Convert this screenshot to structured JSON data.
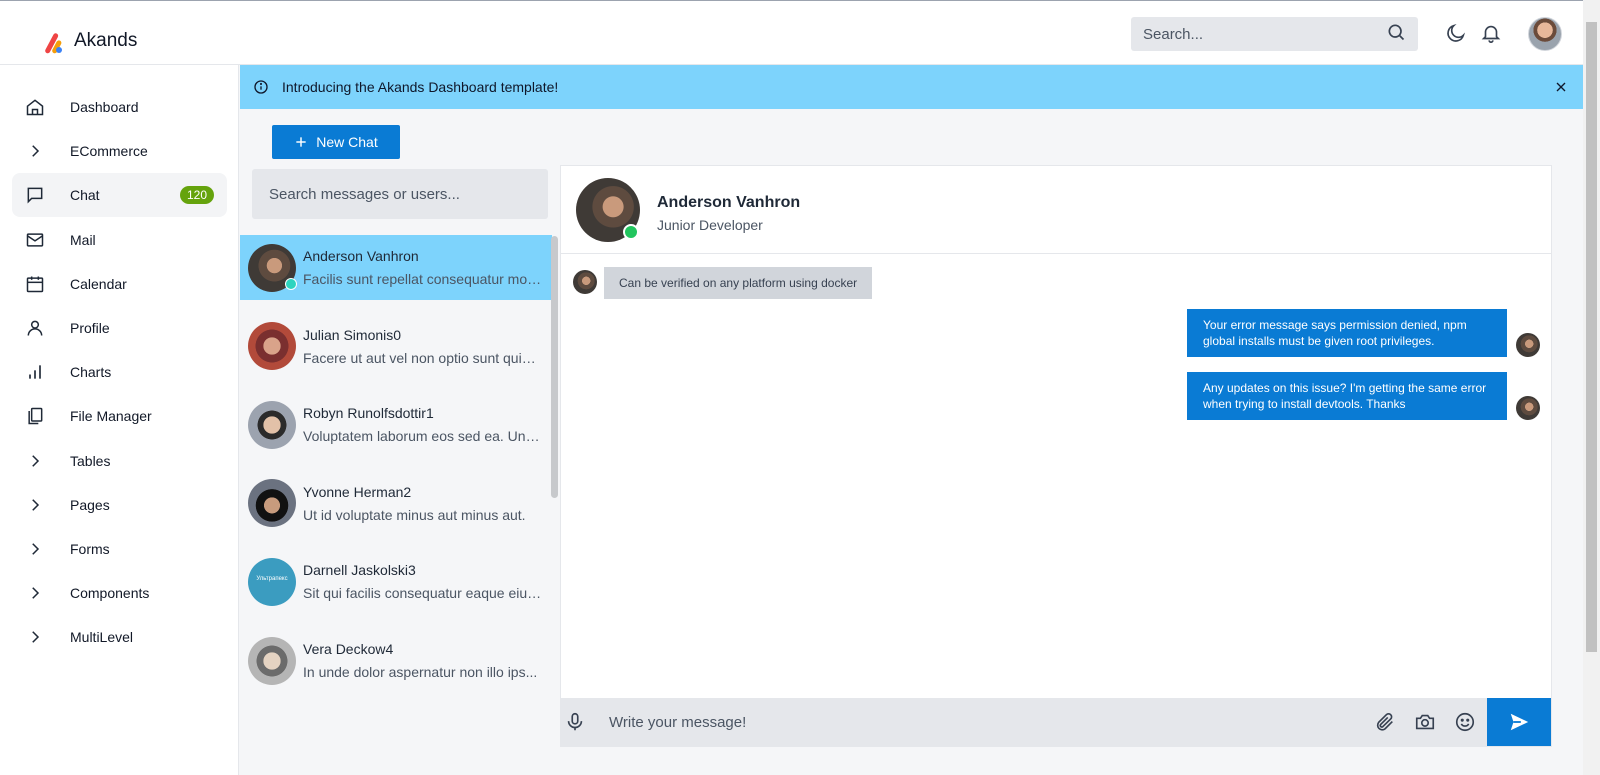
{
  "brand": {
    "name": "Akands"
  },
  "topbar": {
    "search_placeholder": "Search..."
  },
  "sidebar": {
    "items": [
      {
        "label": "Dashboard",
        "icon": "home-icon"
      },
      {
        "label": "ECommerce",
        "icon": "chevron-right-icon"
      },
      {
        "label": "Chat",
        "icon": "chat-icon",
        "badge": "120",
        "active": true
      },
      {
        "label": "Mail",
        "icon": "mail-icon"
      },
      {
        "label": "Calendar",
        "icon": "calendar-icon"
      },
      {
        "label": "Profile",
        "icon": "user-icon"
      },
      {
        "label": "Charts",
        "icon": "bar-chart-icon"
      },
      {
        "label": "File Manager",
        "icon": "files-icon"
      },
      {
        "label": "Tables",
        "icon": "chevron-right-icon"
      },
      {
        "label": "Pages",
        "icon": "chevron-right-icon"
      },
      {
        "label": "Forms",
        "icon": "chevron-right-icon"
      },
      {
        "label": "Components",
        "icon": "chevron-right-icon"
      },
      {
        "label": "MultiLevel",
        "icon": "chevron-right-icon"
      }
    ]
  },
  "alert": {
    "text": "Introducing the Akands Dashboard template!"
  },
  "new_chat": {
    "label": "New Chat"
  },
  "chat_list": {
    "search_placeholder": "Search messages or users...",
    "contacts": [
      {
        "name": "Anderson Vanhron",
        "preview": "Facilis sunt repellat consequatur mod...",
        "active": true
      },
      {
        "name": "Julian Simonis0",
        "preview": "Facere ut aut vel non optio sunt quia...."
      },
      {
        "name": "Robyn Runolfsdottir1",
        "preview": "Voluptatem laborum eos sed ea. Und..."
      },
      {
        "name": "Yvonne Herman2",
        "preview": "Ut id voluptate minus aut minus aut."
      },
      {
        "name": "Darnell Jaskolski3",
        "preview": "Sit qui facilis consequatur eaque eius...",
        "avatar_text": "Ультрапекс"
      },
      {
        "name": "Vera Deckow4",
        "preview": "In unde dolor aspernatur non illo ips..."
      }
    ]
  },
  "conversation": {
    "name": "Anderson Vanhron",
    "role": "Junior Developer",
    "messages": [
      {
        "direction": "in",
        "text": "Can be verified on any platform using docker"
      },
      {
        "direction": "out",
        "text": "Your error message says permission denied, npm global installs must be given root privileges."
      },
      {
        "direction": "out",
        "text": "Any updates on this issue? I'm getting the same error when trying to install devtools. Thanks"
      }
    ],
    "composer_placeholder": "Write your message!"
  },
  "colors": {
    "accent": "#0a7bd4",
    "alert": "#7dd3fc",
    "badge": "#65a30d",
    "online": "#22c55e"
  }
}
